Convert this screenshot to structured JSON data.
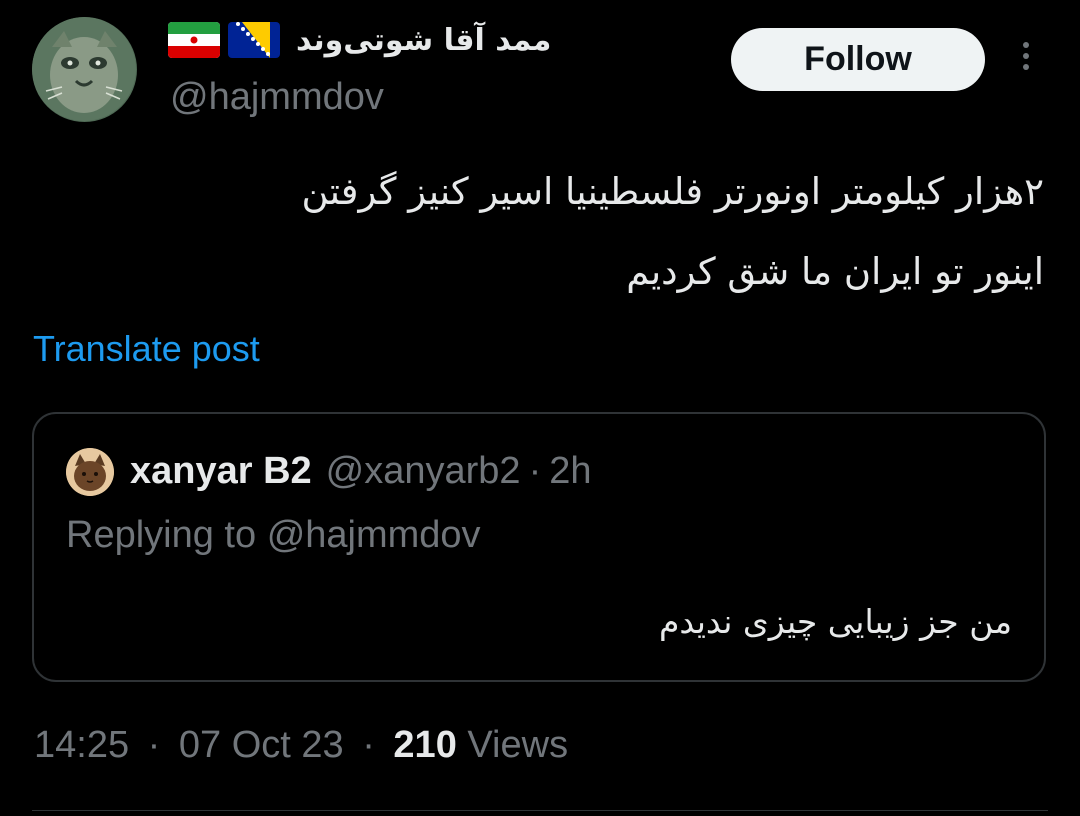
{
  "author": {
    "display_name": "ممد آقا شوتی‌وند",
    "handle": "@hajmmdov",
    "flags": [
      "iran-flag",
      "bosnia-flag"
    ]
  },
  "actions": {
    "follow_label": "Follow",
    "more_icon": "more-vertical-icon"
  },
  "post": {
    "lines": [
      "۲هزار کیلومتر اونورتر فلسطینیا اسیر کنیز گرفتن",
      "اینور تو ایران ما شق کردیم"
    ],
    "translate_label": "Translate post"
  },
  "quote": {
    "name": "xanyar B2",
    "handle": "@xanyarb2",
    "separator": "·",
    "time": "2h",
    "replying_prefix": "Replying to",
    "replying_to": "@hajmmdov",
    "text": "من جز زیبایی چیزی ندیدم"
  },
  "meta": {
    "time": "14:25",
    "separator": "·",
    "date": "07 Oct 23",
    "views_count": "210",
    "views_label": "Views"
  },
  "colors": {
    "background": "#000000",
    "text": "#e7e9ea",
    "muted": "#71767b",
    "link": "#1d9bf0",
    "border": "#2f3336",
    "button_bg": "#eff3f4"
  }
}
